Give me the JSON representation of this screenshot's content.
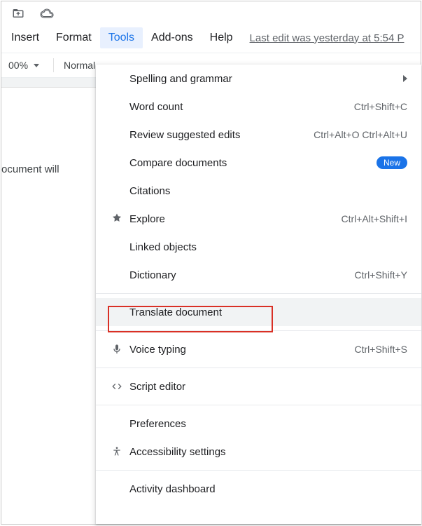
{
  "icon_row": {
    "move_to": "move-to-icon",
    "cloud": "cloud-icon"
  },
  "menubar": {
    "items": [
      "Insert",
      "Format",
      "Tools",
      "Add-ons",
      "Help"
    ],
    "active_index": 2,
    "last_edit": "Last edit was yesterday at 5:54 P"
  },
  "toolbar": {
    "zoom": "00%",
    "style": "Normal"
  },
  "doc_body_text": "ocument will",
  "dropdown": {
    "items": [
      {
        "label": "Spelling and grammar",
        "shortcut": "",
        "icon": "",
        "submenu": true
      },
      {
        "label": "Word count",
        "shortcut": "Ctrl+Shift+C",
        "icon": ""
      },
      {
        "label": "Review suggested edits",
        "shortcut": "Ctrl+Alt+O Ctrl+Alt+U",
        "icon": ""
      },
      {
        "label": "Compare documents",
        "shortcut": "",
        "icon": "",
        "badge": "New"
      },
      {
        "label": "Citations",
        "shortcut": "",
        "icon": ""
      },
      {
        "label": "Explore",
        "shortcut": "Ctrl+Alt+Shift+I",
        "icon": "explore"
      },
      {
        "label": "Linked objects",
        "shortcut": "",
        "icon": ""
      },
      {
        "label": "Dictionary",
        "shortcut": "Ctrl+Shift+Y",
        "icon": ""
      },
      {
        "divider": true
      },
      {
        "label": "Translate document",
        "shortcut": "",
        "icon": "",
        "highlighted": true
      },
      {
        "divider": true
      },
      {
        "label": "Voice typing",
        "shortcut": "Ctrl+Shift+S",
        "icon": "mic"
      },
      {
        "divider": true
      },
      {
        "label": "Script editor",
        "shortcut": "",
        "icon": "code"
      },
      {
        "divider": true
      },
      {
        "label": "Preferences",
        "shortcut": "",
        "icon": ""
      },
      {
        "label": "Accessibility settings",
        "shortcut": "",
        "icon": "acc"
      },
      {
        "divider": true
      },
      {
        "label": "Activity dashboard",
        "shortcut": "",
        "icon": ""
      }
    ]
  },
  "bottom_truncated": ""
}
